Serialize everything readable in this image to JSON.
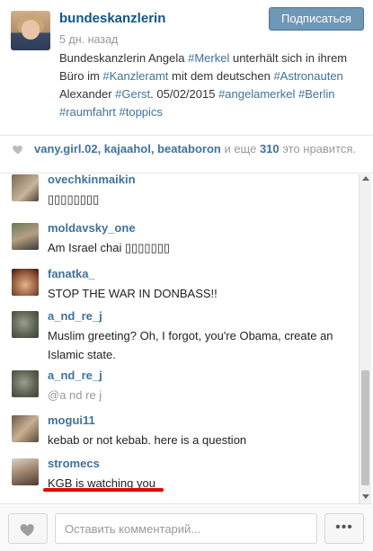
{
  "post": {
    "username": "bundeskanzlerin",
    "time_ago": "5 дн. назад",
    "follow_label": "Подписаться",
    "caption": {
      "t1": "Bundeskanzlerin Angela ",
      "tag_merkel": "#Merkel",
      "t2": " unterhält sich in ihrem Büro im ",
      "tag_kanzleramt": "#Kanzleramt",
      "t3": " mit dem deutschen ",
      "tag_astronauten": "#Astronauten",
      "t4": " Alexander ",
      "tag_gerst": "#Gerst",
      "t5": ". 05/02/2015 ",
      "tag_angelamerkel": "#angelamerkel",
      "tag_berlin": "#Berlin",
      "tag_raumfahrt": "#raumfahrt",
      "tag_toppics": "#toppics"
    }
  },
  "likes": {
    "users": "vany.girl.02, kajaahol, beataboron",
    "middle": " и еще ",
    "count": "310",
    "suffix": " это нравится."
  },
  "comments": [
    {
      "user": "ovechkinmaikin",
      "text": "▯▯▯▯▯▯▯▯"
    },
    {
      "user": "moldavsky_one",
      "text": "Am Israel chai ▯▯▯▯▯▯▯"
    },
    {
      "user": "fanatka_",
      "text": "STOP THE WAR IN DONBASS!!"
    },
    {
      "user": "a_nd_re_j",
      "text": "Muslim greeting? Oh, I forgot, you're Obama, create an Islamic state."
    },
    {
      "user": "a_nd_re_j",
      "text": "@a nd re j"
    },
    {
      "user": "mogui11",
      "text": "kebab or not kebab. here is a question"
    },
    {
      "user": "stromecs",
      "text": "KGB is watching you"
    }
  ],
  "footer": {
    "comment_placeholder": "Оставить комментарий...",
    "more_label": "•••"
  },
  "colors": {
    "link": "#3f729b",
    "follow_button": "#6f97b6",
    "highlight_underline": "#e60000"
  }
}
